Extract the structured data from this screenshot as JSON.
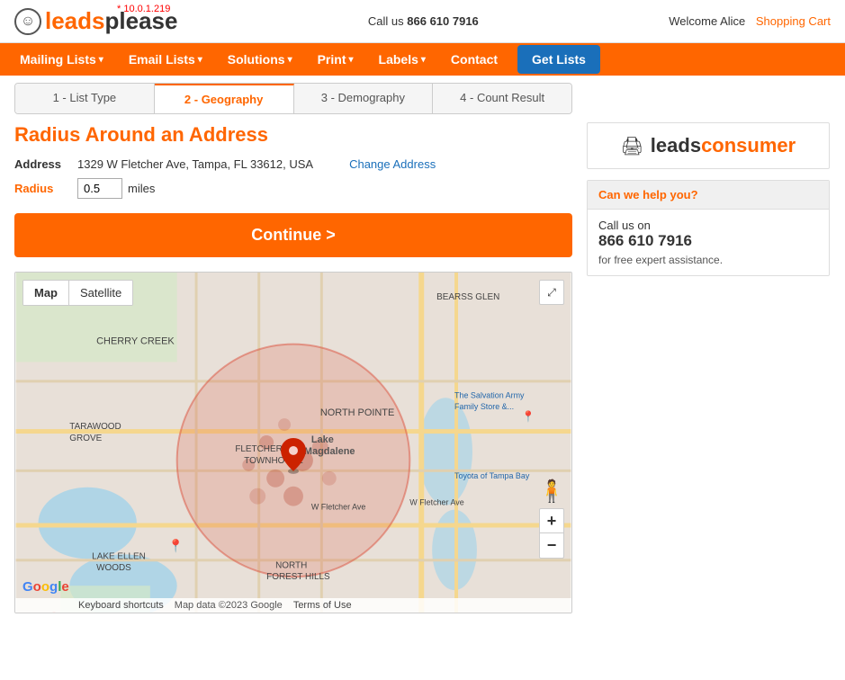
{
  "header": {
    "logo_leads": "leads",
    "logo_please": "please",
    "logo_icon": "☺",
    "version": "* 10.0.1.219",
    "call_label": "Call us",
    "phone": "866 610 7916",
    "welcome": "Welcome Alice",
    "shopping_cart": "Shopping Cart"
  },
  "nav": {
    "items": [
      {
        "label": "Mailing Lists",
        "arrow": "▾"
      },
      {
        "label": "Email Lists",
        "arrow": "▾"
      },
      {
        "label": "Solutions",
        "arrow": "▾"
      },
      {
        "label": "Print",
        "arrow": "▾"
      },
      {
        "label": "Labels",
        "arrow": "▾"
      },
      {
        "label": "Contact",
        "arrow": ""
      },
      {
        "label": "Get Lists",
        "arrow": ""
      }
    ]
  },
  "breadcrumb": {
    "steps": [
      {
        "label": "1 - List Type",
        "active": false
      },
      {
        "label": "2 - Geography",
        "active": true
      },
      {
        "label": "3 - Demography",
        "active": false
      },
      {
        "label": "4 - Count Result",
        "active": false
      }
    ]
  },
  "page": {
    "title": "Radius Around an Address",
    "address_label": "Address",
    "address_value": "1329 W Fletcher Ave, Tampa, FL 33612, USA",
    "change_link": "Change Address",
    "radius_label": "Radius",
    "radius_value": "0.5",
    "radius_unit": "miles",
    "continue_button": "Continue >"
  },
  "map": {
    "tab_map": "Map",
    "tab_satellite": "Satellite",
    "zoom_in": "+",
    "zoom_out": "−",
    "footer_shortcuts": "Keyboard shortcuts",
    "footer_data": "Map data ©2023 Google",
    "footer_terms": "Terms of Use",
    "google_letters": [
      "G",
      "o",
      "o",
      "g",
      "l",
      "e"
    ]
  },
  "sidebar": {
    "logo_leads": "leads",
    "logo_consumer": "consumer",
    "printer_icon": "🖨",
    "help_header": "Can we help you?",
    "help_call": "Call us on",
    "help_phone": "866 610 7916",
    "help_sub": "for free expert assistance."
  }
}
